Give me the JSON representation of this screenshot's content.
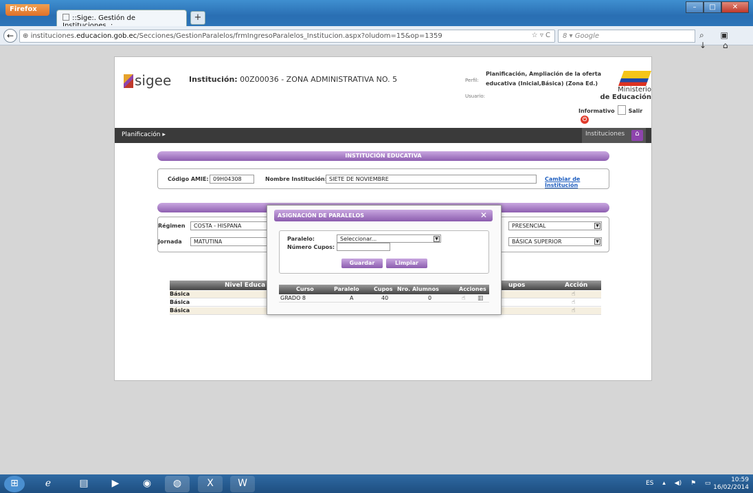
{
  "browser": {
    "app_button": "Firefox",
    "tab_title": "::Sige:. Gestión de Instituciones .:",
    "new_tab": "+",
    "url_prefix": "instituciones.",
    "url_domain": "educacion.gob.ec",
    "url_path": "/Secciones/GestionParalelos/frmIngresoParalelos_Institucion.aspx?oludom=15&op=1359",
    "search_placeholder": "Google",
    "back": "←",
    "nav_right": "⌕ ▣ ↓ ⌂"
  },
  "header": {
    "logo_text": "sigee",
    "institucion_label": "Institución:",
    "institucion_value": "00Z00036 - ZONA ADMINISTRATIVA NO. 5",
    "perfil_label": "Perfil:",
    "perfil_value": "Planificación, Ampliación de la oferta educativa (Inicial,Básica) (Zona Ed.)",
    "usuario_label": "Usuario:",
    "ministry_line1": "Ministerio",
    "ministry_line2": "de Educación",
    "informativo": "Informativo",
    "salir": "Salir"
  },
  "menu": {
    "planificacion": "Planificación",
    "instituciones": "Instituciones"
  },
  "section": {
    "title": "INSTITUCIÓN EDUCATIVA",
    "codigo_label": "Código AMIE:",
    "codigo_value": "09H04308",
    "nombre_label": "Nombre Institución:",
    "nombre_value": "SIETE DE NOVIEMBRE",
    "cambiar": "Cambiar de Institución"
  },
  "filters": {
    "regimen_label": "Régimen",
    "regimen_value": "COSTA - HISPANA",
    "jornada_label": "Jornada",
    "jornada_value": "MATUTINA",
    "modalidad_value": "PRESENCIAL",
    "nivel_value": "BÁSICA SUPERIOR"
  },
  "main_table": {
    "headers": [
      "Nivel Educa",
      "upos",
      "Acción"
    ],
    "rows": [
      "Básica",
      "Básica",
      "Básica"
    ]
  },
  "dialog": {
    "title": "ASIGNACIÓN DE PARALELOS",
    "close": "✕",
    "paralelo_label": "Paralelo:",
    "paralelo_value": "Seleccionar...",
    "cupos_label": "Número Cupos:",
    "guardar": "Guardar",
    "limpiar": "Limpiar",
    "headers": [
      "Curso",
      "Paralelo",
      "Cupos",
      "Nro. Alumnos",
      "Acciones"
    ],
    "row": {
      "curso": "GRADO 8",
      "paralelo": "A",
      "cupos": "40",
      "alumnos": "0"
    }
  },
  "taskbar": {
    "lang": "ES",
    "time": "10:59",
    "date": "16/02/2014"
  }
}
